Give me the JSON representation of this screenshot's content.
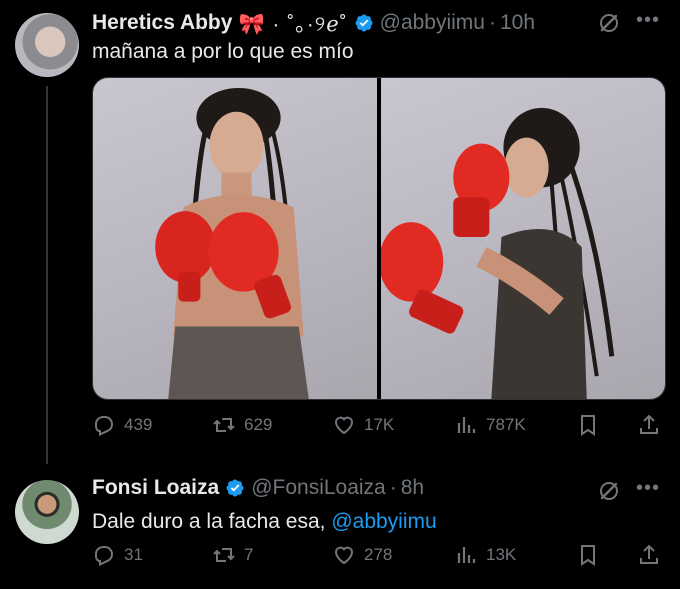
{
  "colors": {
    "background": "#000000",
    "text": "#e7e9ea",
    "muted": "#71767b",
    "link": "#1d9bf0",
    "verified": "#1d9bf0"
  },
  "tweets": [
    {
      "display_name": "Heretics Abby",
      "name_decoration": "🎀 · ˚｡·୨ℯ˚",
      "handle": "@abbyiimu",
      "time": "10h",
      "text": "mañana a por lo que es mío",
      "mention": "",
      "has_media": true,
      "media_count": 2,
      "stats": {
        "replies": "439",
        "reposts": "629",
        "likes": "17K",
        "views": "787K"
      }
    },
    {
      "display_name": "Fonsi Loaiza",
      "handle": "@FonsiLoaiza",
      "time": "8h",
      "text": "Dale duro a la facha esa, ",
      "mention": "@abbyiimu",
      "has_media": false,
      "stats": {
        "replies": "31",
        "reposts": "7",
        "likes": "278",
        "views": "13K"
      }
    }
  ],
  "separator": "·",
  "icons": [
    "verified-badge-icon",
    "grok-icon",
    "more-icon",
    "reply-icon",
    "repost-icon",
    "like-icon",
    "views-icon",
    "bookmark-icon",
    "share-icon"
  ]
}
